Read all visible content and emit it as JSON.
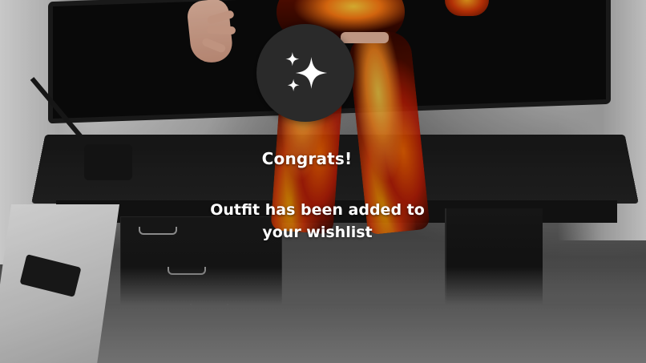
{
  "notification": {
    "icon": "sparkles-icon",
    "title": "Congrats!",
    "message_line1": "Outfit has been added to",
    "message_line2": "your wishlist"
  },
  "colors": {
    "badge_background": "#2a2a2a",
    "text": "#ffffff",
    "flame_primary": "#ff7a12",
    "flame_highlight": "#ffd54a"
  }
}
